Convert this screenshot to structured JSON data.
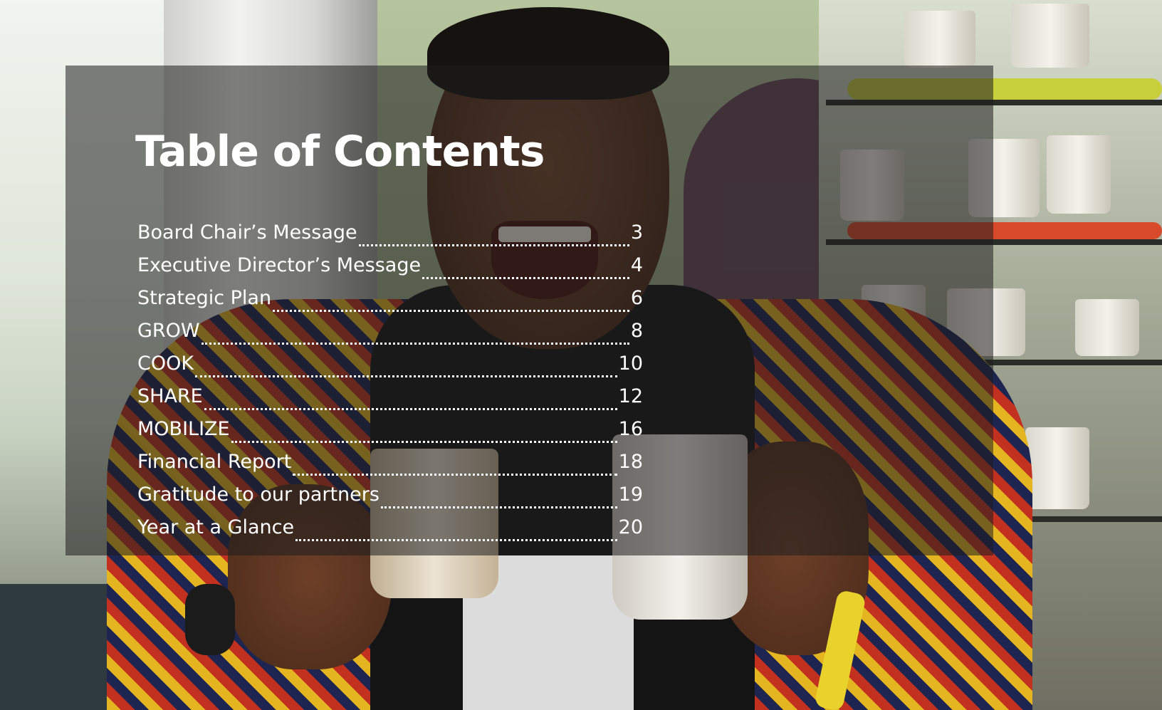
{
  "title": "Table of Contents",
  "entries": [
    {
      "label": "Board Chair’s Message",
      "page": "3"
    },
    {
      "label": "Executive Director’s Message",
      "page": "4"
    },
    {
      "label": "Strategic Plan",
      "page": "6"
    },
    {
      "label": "GROW",
      "page": "8"
    },
    {
      "label": "COOK",
      "page": "10"
    },
    {
      "label": "SHARE",
      "page": "12"
    },
    {
      "label": "MOBILIZE",
      "page": "16"
    },
    {
      "label": "Financial Report",
      "page": "18"
    },
    {
      "label": "Gratitude to our partners",
      "page": "19"
    },
    {
      "label": "Year at a Glance",
      "page": "20"
    }
  ],
  "colors": {
    "text": "#ffffff",
    "overlay": "#1e1e1e"
  }
}
